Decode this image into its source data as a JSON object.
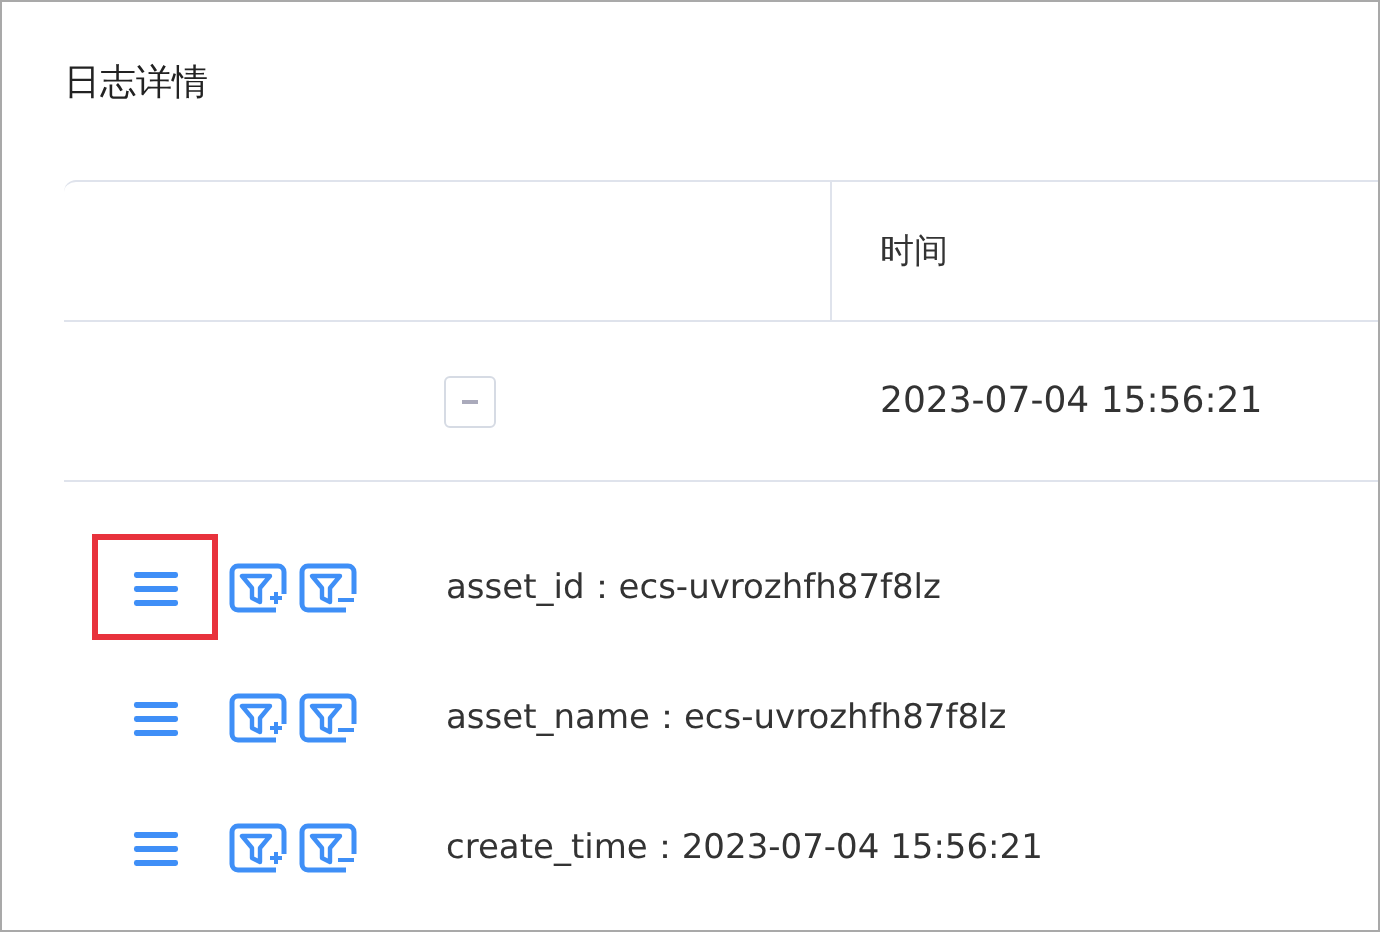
{
  "title": "日志详情",
  "table": {
    "columns": [
      "时间"
    ],
    "rows": [
      {
        "expanded": true,
        "time": "2023-07-04 15:56:21"
      }
    ]
  },
  "fields": [
    {
      "text": "asset_id：ecs-uvrozhfh87f8lz",
      "highlighted": true
    },
    {
      "text": "asset_name：ecs-uvrozhfh87f8lz",
      "highlighted": false
    },
    {
      "text": "create_time：2023-07-04 15:56:21",
      "highlighted": false
    }
  ]
}
